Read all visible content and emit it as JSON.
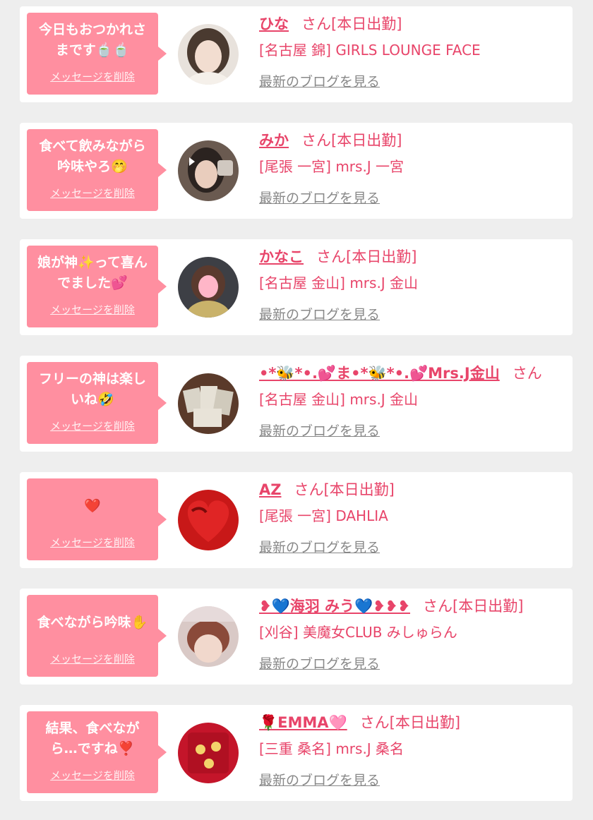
{
  "delete_label": "メッセージを削除",
  "blog_label": "最新のブログを見る",
  "messages": [
    {
      "message": "今日もおつかれさまです🍵🍵",
      "name": "ひな",
      "suffix": "さん[本日出勤]",
      "shop": "[名古屋 錦] GIRLS LOUNGE FACE",
      "avatar_icon": "girl-photo-icon",
      "avatar_colors": [
        "#e8e2dc",
        "#4a3a30"
      ]
    },
    {
      "message": "食べて飲みながら吟味やろ🤭",
      "name": "みか",
      "suffix": "さん[本日出勤]",
      "shop": "[尾張 一宮] mrs.J 一宮",
      "avatar_icon": "girl-photo-icon",
      "avatar_colors": [
        "#6a5a50",
        "#2b2320"
      ]
    },
    {
      "message": "娘が神✨って喜んでました💕",
      "name": "かなこ",
      "suffix": "さん[本日出勤]",
      "shop": "[名古屋 金山] mrs.J 金山",
      "avatar_icon": "girl-photo-icon",
      "avatar_colors": [
        "#3d3f45",
        "#c9b26a"
      ]
    },
    {
      "message": "フリーの神は楽しいね🤣",
      "name": "•*🐝*•.💕ま•*🐝*•.💕Mrs.J金山",
      "suffix": "さん",
      "shop": "[名古屋 金山] mrs.J 金山",
      "avatar_icon": "cards-photo-icon",
      "avatar_colors": [
        "#5a3a2a",
        "#d9d4c8"
      ]
    },
    {
      "message": "❤️",
      "name": "AZ",
      "suffix": "さん[本日出勤]",
      "shop": "[尾張 一宮] DAHLIA",
      "avatar_icon": "red-heart-photo-icon",
      "avatar_colors": [
        "#c81818",
        "#7a0a0a"
      ]
    },
    {
      "message": "食べながら吟味✋",
      "name": "❥💙海羽 みう💙❥❥❥",
      "suffix": "さん[本日出勤]",
      "shop": "[刈谷] 美魔女CLUB みしゅらん",
      "avatar_icon": "girl-photo-icon",
      "avatar_colors": [
        "#d9c9c6",
        "#8a4a3a"
      ]
    },
    {
      "message": "結果、食べながら…ですね❣️",
      "name": "🌹EMMA🩷",
      "suffix": "さん[本日出勤]",
      "shop": "[三重 桑名] mrs.J 桑名",
      "avatar_icon": "red-banner-photo-icon",
      "avatar_colors": [
        "#c4152a",
        "#f3d36b"
      ]
    }
  ]
}
